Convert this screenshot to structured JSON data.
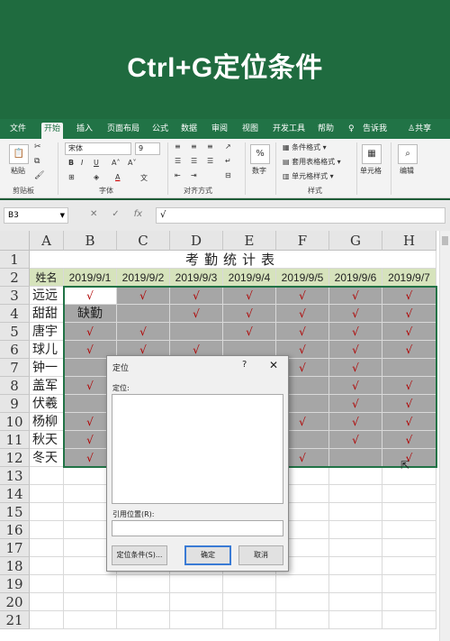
{
  "banner": {
    "title": "Ctrl+G定位条件"
  },
  "ribbon_tabs": [
    "文件",
    "开始",
    "插入",
    "页面布局",
    "公式",
    "数据",
    "审阅",
    "视图",
    "开发工具",
    "帮助"
  ],
  "ribbon_tab_extras": {
    "tell_me": "告诉我",
    "share": "共享"
  },
  "ribbon": {
    "clipboard": {
      "paste": "粘贴",
      "group": "剪贴板"
    },
    "font": {
      "name": "宋体",
      "size": "9",
      "group": "字体"
    },
    "alignment": {
      "group": "对齐方式"
    },
    "number": {
      "btn": "数字"
    },
    "styles": {
      "conditional": "条件格式",
      "table": "套用表格格式",
      "cell_style": "单元格样式",
      "group": "样式"
    },
    "cells": {
      "btn": "单元格"
    },
    "editing": {
      "btn": "编辑"
    }
  },
  "formula_bar": {
    "name_box": "B3",
    "cancel": "✕",
    "enter": "✓",
    "fx": "fx",
    "content": "√"
  },
  "grid": {
    "columns": [
      "A",
      "B",
      "C",
      "D",
      "E",
      "F",
      "G",
      "H"
    ],
    "rows": [
      "1",
      "2",
      "3",
      "4",
      "5",
      "6",
      "7",
      "8",
      "9",
      "10",
      "11",
      "12",
      "13",
      "14",
      "15",
      "16",
      "17",
      "18",
      "19",
      "20",
      "21"
    ],
    "title": "考勤统计表",
    "header": [
      "姓名",
      "2019/9/1",
      "2019/9/2",
      "2019/9/3",
      "2019/9/4",
      "2019/9/5",
      "2019/9/6",
      "2019/9/7"
    ],
    "records": [
      [
        "远远",
        "√",
        "√",
        "√",
        "√",
        "√",
        "√",
        "√"
      ],
      [
        "甜甜",
        "缺勤",
        "",
        "√",
        "√",
        "√",
        "√",
        "√"
      ],
      [
        "唐宇",
        "√",
        "√",
        "",
        "√",
        "√",
        "√",
        "√"
      ],
      [
        "球儿",
        "√",
        "√",
        "√",
        "",
        "√",
        "√",
        "√"
      ],
      [
        "钟一",
        "",
        "",
        "",
        "",
        "√",
        "√",
        ""
      ],
      [
        "盖军",
        "√",
        "",
        "",
        "",
        "",
        "√",
        "√"
      ],
      [
        "伏羲",
        "",
        "",
        "",
        "",
        "",
        "√",
        "√"
      ],
      [
        "杨柳",
        "√",
        "",
        "",
        "",
        "√",
        "√",
        "√"
      ],
      [
        "秋天",
        "√",
        "",
        "",
        "",
        "",
        "√",
        "√"
      ],
      [
        "冬天",
        "√",
        "",
        "",
        "",
        "√",
        "",
        "√"
      ]
    ]
  },
  "dialog": {
    "title": "定位",
    "help": "?",
    "close": "✕",
    "goto_label": "定位:",
    "reference_label": "引用位置(R):",
    "reference_value": "",
    "special_button": "定位条件(S)...",
    "ok_button": "确定",
    "cancel_button": "取消"
  },
  "colors": {
    "accent": "#217346",
    "banner": "#1f6b3f",
    "check": "#b00000",
    "header_fill": "#d6e3bc",
    "selection": "#a6a6a6"
  }
}
